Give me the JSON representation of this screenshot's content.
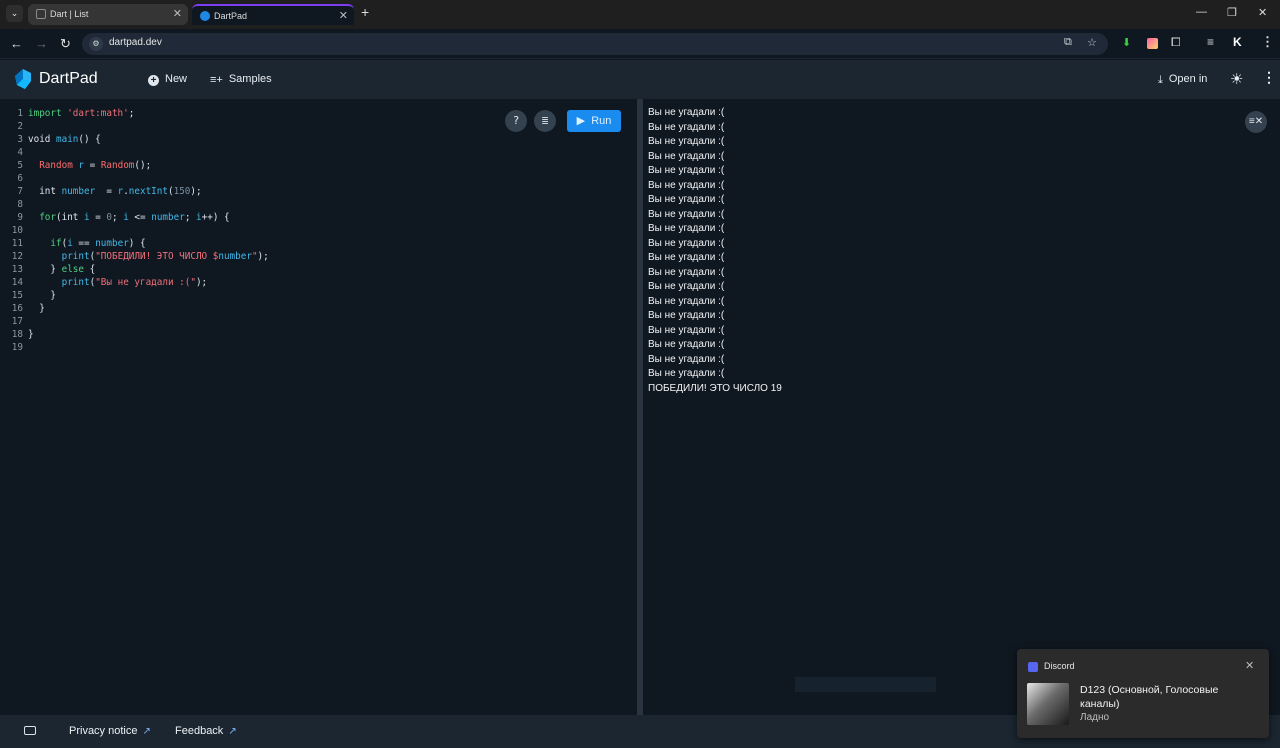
{
  "browser": {
    "tabs": [
      {
        "title": "Dart | List",
        "active": false
      },
      {
        "title": "DartPad",
        "active": true
      }
    ],
    "url": "dartpad.dev",
    "accent": "#7b3ff2"
  },
  "header": {
    "app_title": "DartPad",
    "new_label": "New",
    "samples_label": "Samples",
    "open_in_label": "Open in"
  },
  "editor": {
    "run_label": "Run",
    "lines": [
      [
        {
          "t": "import ",
          "c": "kw"
        },
        {
          "t": "'dart:math'",
          "c": "str"
        },
        {
          "t": ";",
          "c": ""
        }
      ],
      [],
      [
        {
          "t": "void ",
          "c": ""
        },
        {
          "t": "main",
          "c": "fn"
        },
        {
          "t": "() {",
          "c": ""
        }
      ],
      [],
      [
        {
          "t": "  ",
          "c": ""
        },
        {
          "t": "Random",
          "c": "ty"
        },
        {
          "t": " ",
          "c": ""
        },
        {
          "t": "r",
          "c": "var"
        },
        {
          "t": " = ",
          "c": ""
        },
        {
          "t": "Random",
          "c": "ty"
        },
        {
          "t": "();",
          "c": ""
        }
      ],
      [],
      [
        {
          "t": "  int ",
          "c": ""
        },
        {
          "t": "number",
          "c": "var"
        },
        {
          "t": "  = ",
          "c": ""
        },
        {
          "t": "r",
          "c": "var"
        },
        {
          "t": ".",
          "c": ""
        },
        {
          "t": "nextInt",
          "c": "fn"
        },
        {
          "t": "(",
          "c": ""
        },
        {
          "t": "150",
          "c": "num"
        },
        {
          "t": ");",
          "c": ""
        }
      ],
      [],
      [
        {
          "t": "  ",
          "c": ""
        },
        {
          "t": "for",
          "c": "kw"
        },
        {
          "t": "(int ",
          "c": ""
        },
        {
          "t": "i",
          "c": "var"
        },
        {
          "t": " = ",
          "c": ""
        },
        {
          "t": "0",
          "c": "num"
        },
        {
          "t": "; ",
          "c": ""
        },
        {
          "t": "i",
          "c": "var"
        },
        {
          "t": " <= ",
          "c": ""
        },
        {
          "t": "number",
          "c": "var"
        },
        {
          "t": "; ",
          "c": ""
        },
        {
          "t": "i",
          "c": "var"
        },
        {
          "t": "++) {",
          "c": ""
        }
      ],
      [],
      [
        {
          "t": "    ",
          "c": ""
        },
        {
          "t": "if",
          "c": "kw"
        },
        {
          "t": "(",
          "c": ""
        },
        {
          "t": "i",
          "c": "var"
        },
        {
          "t": " == ",
          "c": ""
        },
        {
          "t": "number",
          "c": "var"
        },
        {
          "t": ") {",
          "c": ""
        }
      ],
      [
        {
          "t": "      ",
          "c": ""
        },
        {
          "t": "print",
          "c": "fn"
        },
        {
          "t": "(",
          "c": ""
        },
        {
          "t": "\"ПОБЕДИЛИ! ЭТО ЧИСЛО $",
          "c": "str"
        },
        {
          "t": "number",
          "c": "var"
        },
        {
          "t": "\"",
          "c": "str"
        },
        {
          "t": ");",
          "c": ""
        }
      ],
      [
        {
          "t": "    } ",
          "c": ""
        },
        {
          "t": "else",
          "c": "kw"
        },
        {
          "t": " {",
          "c": ""
        }
      ],
      [
        {
          "t": "      ",
          "c": ""
        },
        {
          "t": "print",
          "c": "fn"
        },
        {
          "t": "(",
          "c": ""
        },
        {
          "t": "\"Вы не угадали :(\"",
          "c": "str"
        },
        {
          "t": ");",
          "c": ""
        }
      ],
      [
        {
          "t": "    }",
          "c": ""
        }
      ],
      [
        {
          "t": "  }",
          "c": ""
        }
      ],
      [],
      [
        {
          "t": "}",
          "c": ""
        }
      ],
      []
    ]
  },
  "console": {
    "output": [
      "Вы не угадали :(",
      "Вы не угадали :(",
      "Вы не угадали :(",
      "Вы не угадали :(",
      "Вы не угадали :(",
      "Вы не угадали :(",
      "Вы не угадали :(",
      "Вы не угадали :(",
      "Вы не угадали :(",
      "Вы не угадали :(",
      "Вы не угадали :(",
      "Вы не угадали :(",
      "Вы не угадали :(",
      "Вы не угадали :(",
      "Вы не угадали :(",
      "Вы не угадали :(",
      "Вы не угадали :(",
      "Вы не угадали :(",
      "Вы не угадали :(",
      "ПОБЕДИЛИ! ЭТО ЧИСЛО 19"
    ]
  },
  "footer": {
    "privacy_label": "Privacy notice",
    "feedback_label": "Feedback"
  },
  "notification": {
    "app_name": "Discord",
    "title": "D123 (Основной, Голосовые каналы)",
    "body": "Ладно"
  }
}
